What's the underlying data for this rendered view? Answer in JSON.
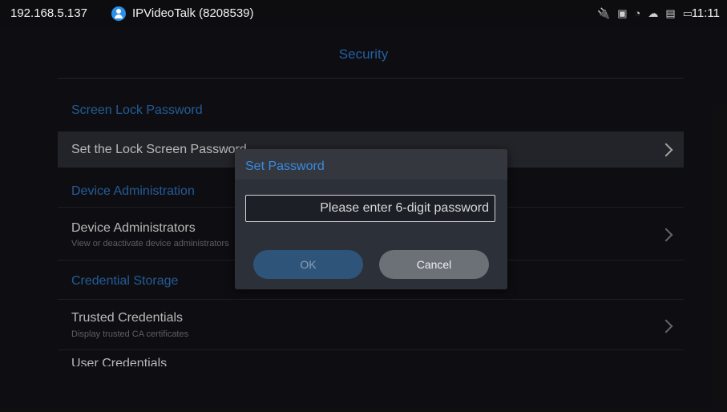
{
  "status_bar": {
    "ip": "192.168.5.137",
    "account_icon": "account-icon",
    "account_title": "IPVideoTalk (8208539)",
    "icons": [
      "usb-icon",
      "image-icon",
      "wifi-icon",
      "cloud-icon",
      "sim-icon",
      "display-icon"
    ],
    "time": "11:11"
  },
  "header": {
    "title": "Security"
  },
  "list": {
    "screen_lock_section": "Screen Lock Password",
    "set_lock_password": "Set the Lock Screen Password",
    "device_admin_section": "Device Administration",
    "device_administrators": "Device Administrators",
    "device_administrators_sub": "View or deactivate device administrators",
    "credential_storage_section": "Credential Storage",
    "trusted_credentials": "Trusted Credentials",
    "trusted_credentials_sub": "Display trusted CA certificates",
    "user_credentials": "User Credentials"
  },
  "dialog": {
    "title": "Set Password",
    "input_placeholder": "Please enter 6-digit password",
    "input_value": "",
    "ok_label": "OK",
    "cancel_label": "Cancel"
  },
  "colors": {
    "accent": "#3a8ae0",
    "section_header": "#2c6fb8",
    "ok_button_disabled": "#2e5579",
    "cancel_button": "#6c7077"
  }
}
